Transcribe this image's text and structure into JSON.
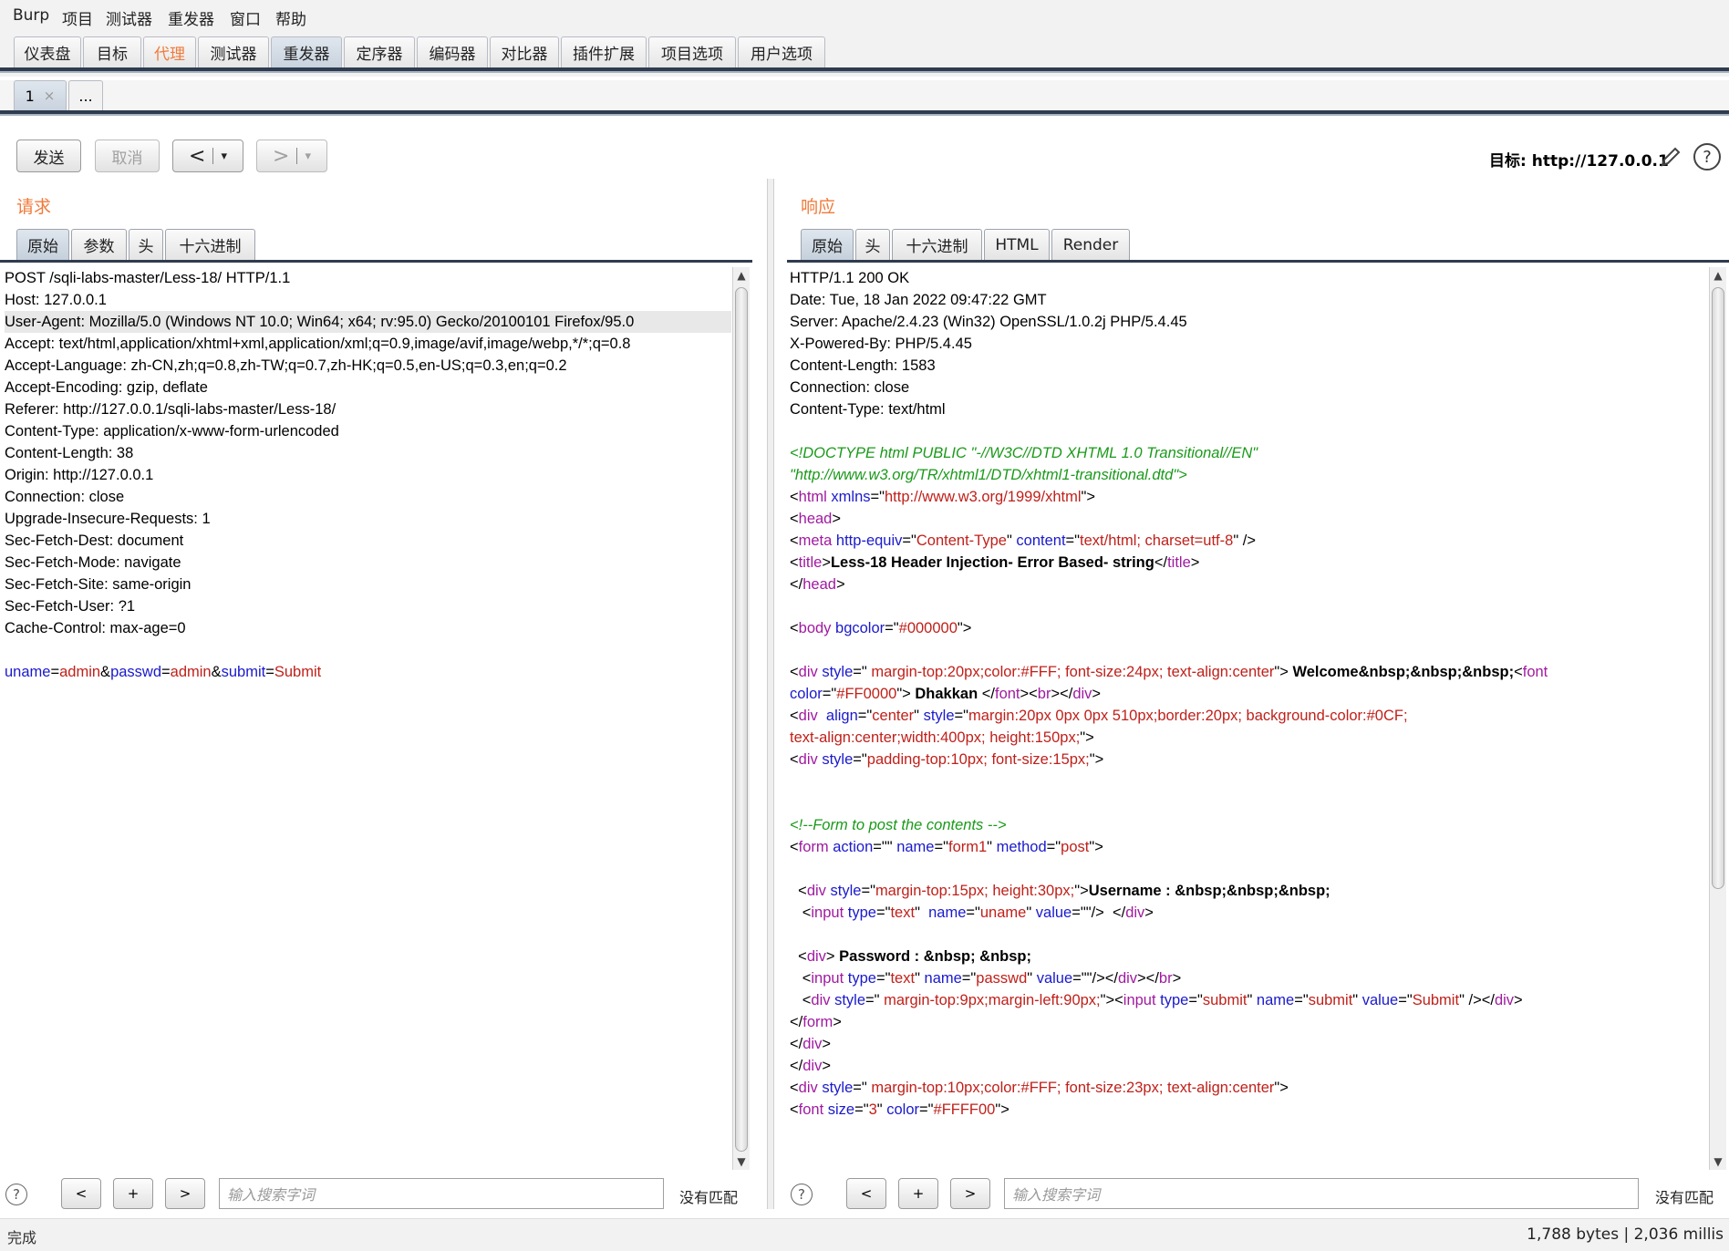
{
  "menu": [
    "Burp",
    "项目",
    "测试器",
    "重发器",
    "窗口",
    "帮助"
  ],
  "main_tabs": [
    "仪表盘",
    "目标",
    "代理",
    "测试器",
    "重发器",
    "定序器",
    "编码器",
    "对比器",
    "插件扩展",
    "项目选项",
    "用户选项"
  ],
  "repeater_tabs": {
    "tab1": "1",
    "close": "×",
    "more": "..."
  },
  "toolbar": {
    "send": "发送",
    "cancel": "取消",
    "back": "<",
    "forward": ">",
    "dropdown": "▾",
    "target_label": "目标:",
    "target_url": "http://127.0.0.1"
  },
  "request": {
    "title": "请求",
    "tabs": [
      "原始",
      "参数",
      "头",
      "十六进制"
    ],
    "lines": [
      "POST /sqli-labs-master/Less-18/ HTTP/1.1",
      "Host: 127.0.0.1",
      "User-Agent: Mozilla/5.0 (Windows NT 10.0; Win64; x64; rv:95.0) Gecko/20100101 Firefox/95.0",
      "Accept: text/html,application/xhtml+xml,application/xml;q=0.9,image/avif,image/webp,*/*;q=0.8",
      "Accept-Language: zh-CN,zh;q=0.8,zh-TW;q=0.7,zh-HK;q=0.5,en-US;q=0.3,en;q=0.2",
      "Accept-Encoding: gzip, deflate",
      "Referer: http://127.0.0.1/sqli-labs-master/Less-18/",
      "Content-Type: application/x-www-form-urlencoded",
      "Content-Length: 38",
      "Origin: http://127.0.0.1",
      "Connection: close",
      "Upgrade-Insecure-Requests: 1",
      "Sec-Fetch-Dest: document",
      "Sec-Fetch-Mode: navigate",
      "Sec-Fetch-Site: same-origin",
      "Sec-Fetch-User: ?1",
      "Cache-Control: max-age=0"
    ],
    "body_params": [
      {
        "name": "uname",
        "value": "admin"
      },
      {
        "name": "passwd",
        "value": "admin"
      },
      {
        "name": "submit",
        "value": "Submit"
      }
    ]
  },
  "response": {
    "title": "响应",
    "tabs": [
      "原始",
      "头",
      "十六进制",
      "HTML",
      "Render"
    ],
    "headers": [
      "HTTP/1.1 200 OK",
      "Date: Tue, 18 Jan 2022 09:47:22 GMT",
      "Server: Apache/2.4.23 (Win32) OpenSSL/1.0.2j PHP/5.4.45",
      "X-Powered-By: PHP/5.4.45",
      "Content-Length: 1583",
      "Connection: close",
      "Content-Type: text/html"
    ],
    "html_lines": [
      [
        [
          "c",
          "<!DOCTYPE html PUBLIC \"-//W3C//DTD XHTML 1.0 Transitional//EN\""
        ]
      ],
      [
        [
          "c",
          "\"http://www.w3.org/TR/xhtml1/DTD/xhtml1-transitional.dtd\">"
        ]
      ],
      [
        [
          "p",
          "<"
        ],
        [
          "t",
          "html"
        ],
        [
          "p",
          " "
        ],
        [
          "a",
          "xmlns"
        ],
        [
          "p",
          "=\""
        ],
        [
          "v",
          "http://www.w3.org/1999/xhtml"
        ],
        [
          "p",
          "\">"
        ]
      ],
      [
        [
          "p",
          "<"
        ],
        [
          "t",
          "head"
        ],
        [
          "p",
          ">"
        ]
      ],
      [
        [
          "p",
          "<"
        ],
        [
          "t",
          "meta"
        ],
        [
          "p",
          " "
        ],
        [
          "a",
          "http-equiv"
        ],
        [
          "p",
          "=\""
        ],
        [
          "v",
          "Content-Type"
        ],
        [
          "p",
          "\" "
        ],
        [
          "a",
          "content"
        ],
        [
          "p",
          "=\""
        ],
        [
          "v",
          "text/html; charset=utf-8"
        ],
        [
          "p",
          "\" />"
        ]
      ],
      [
        [
          "p",
          "<"
        ],
        [
          "t",
          "title"
        ],
        [
          "p",
          ">"
        ],
        [
          "b",
          "Less-18 Header Injection- Error Based- string"
        ],
        [
          "p",
          "</"
        ],
        [
          "t",
          "title"
        ],
        [
          "p",
          ">"
        ]
      ],
      [
        [
          "p",
          "</"
        ],
        [
          "t",
          "head"
        ],
        [
          "p",
          ">"
        ]
      ],
      [],
      [
        [
          "p",
          "<"
        ],
        [
          "t",
          "body"
        ],
        [
          "p",
          " "
        ],
        [
          "a",
          "bgcolor"
        ],
        [
          "p",
          "=\""
        ],
        [
          "v",
          "#000000"
        ],
        [
          "p",
          "\">"
        ]
      ],
      [],
      [
        [
          "p",
          "<"
        ],
        [
          "t",
          "div"
        ],
        [
          "p",
          " "
        ],
        [
          "a",
          "style"
        ],
        [
          "p",
          "=\""
        ],
        [
          "v",
          " margin-top:20px;color:#FFF; font-size:24px; text-align:center"
        ],
        [
          "p",
          "\"> "
        ],
        [
          "b",
          "Welcome&nbsp;&nbsp;&nbsp;"
        ],
        [
          "p",
          "<"
        ],
        [
          "t",
          "font"
        ]
      ],
      [
        [
          "a",
          "color"
        ],
        [
          "p",
          "=\""
        ],
        [
          "v",
          "#FF0000"
        ],
        [
          "p",
          "\"> "
        ],
        [
          "b",
          "Dhakkan"
        ],
        [
          "p",
          " </"
        ],
        [
          "t",
          "font"
        ],
        [
          "p",
          "><"
        ],
        [
          "t",
          "br"
        ],
        [
          "p",
          "></"
        ],
        [
          "t",
          "div"
        ],
        [
          "p",
          ">"
        ]
      ],
      [
        [
          "p",
          "<"
        ],
        [
          "t",
          "div"
        ],
        [
          "p",
          "  "
        ],
        [
          "a",
          "align"
        ],
        [
          "p",
          "=\""
        ],
        [
          "v",
          "center"
        ],
        [
          "p",
          "\" "
        ],
        [
          "a",
          "style"
        ],
        [
          "p",
          "=\""
        ],
        [
          "v",
          "margin:20px 0px 0px 510px;border:20px; background-color:#0CF;"
        ]
      ],
      [
        [
          "v",
          "text-align:center;width:400px; height:150px;"
        ],
        [
          "p",
          "\">"
        ]
      ],
      [
        [
          "p",
          "<"
        ],
        [
          "t",
          "div"
        ],
        [
          "p",
          " "
        ],
        [
          "a",
          "style"
        ],
        [
          "p",
          "=\""
        ],
        [
          "v",
          "padding-top:10px; font-size:15px;"
        ],
        [
          "p",
          "\">"
        ]
      ],
      [],
      [],
      [
        [
          "c",
          "<!--Form to post the contents -->"
        ]
      ],
      [
        [
          "p",
          "<"
        ],
        [
          "t",
          "form"
        ],
        [
          "p",
          " "
        ],
        [
          "a",
          "action"
        ],
        [
          "p",
          "=\"\" "
        ],
        [
          "a",
          "name"
        ],
        [
          "p",
          "=\""
        ],
        [
          "v",
          "form1"
        ],
        [
          "p",
          "\" "
        ],
        [
          "a",
          "method"
        ],
        [
          "p",
          "=\""
        ],
        [
          "v",
          "post"
        ],
        [
          "p",
          "\">"
        ]
      ],
      [],
      [
        [
          "p",
          "  <"
        ],
        [
          "t",
          "div"
        ],
        [
          "p",
          " "
        ],
        [
          "a",
          "style"
        ],
        [
          "p",
          "=\""
        ],
        [
          "v",
          "margin-top:15px; height:30px;"
        ],
        [
          "p",
          "\">"
        ],
        [
          "b",
          "Username : &nbsp;&nbsp;&nbsp;"
        ]
      ],
      [
        [
          "p",
          "   <"
        ],
        [
          "t",
          "input"
        ],
        [
          "p",
          " "
        ],
        [
          "a",
          "type"
        ],
        [
          "p",
          "=\""
        ],
        [
          "v",
          "text"
        ],
        [
          "p",
          "\"  "
        ],
        [
          "a",
          "name"
        ],
        [
          "p",
          "=\""
        ],
        [
          "v",
          "uname"
        ],
        [
          "p",
          "\" "
        ],
        [
          "a",
          "value"
        ],
        [
          "p",
          "=\"\"/>  </"
        ],
        [
          "t",
          "div"
        ],
        [
          "p",
          ">"
        ]
      ],
      [],
      [
        [
          "p",
          "  <"
        ],
        [
          "t",
          "div"
        ],
        [
          "p",
          "> "
        ],
        [
          "b",
          "Password : &nbsp; &nbsp;"
        ]
      ],
      [
        [
          "p",
          "   <"
        ],
        [
          "t",
          "input"
        ],
        [
          "p",
          " "
        ],
        [
          "a",
          "type"
        ],
        [
          "p",
          "=\""
        ],
        [
          "v",
          "text"
        ],
        [
          "p",
          "\" "
        ],
        [
          "a",
          "name"
        ],
        [
          "p",
          "=\""
        ],
        [
          "v",
          "passwd"
        ],
        [
          "p",
          "\" "
        ],
        [
          "a",
          "value"
        ],
        [
          "p",
          "=\"\"/></"
        ],
        [
          "t",
          "div"
        ],
        [
          "p",
          "></"
        ],
        [
          "t",
          "br"
        ],
        [
          "p",
          ">"
        ]
      ],
      [
        [
          "p",
          "   <"
        ],
        [
          "t",
          "div"
        ],
        [
          "p",
          " "
        ],
        [
          "a",
          "style"
        ],
        [
          "p",
          "=\""
        ],
        [
          "v",
          " margin-top:9px;margin-left:90px;"
        ],
        [
          "p",
          "\"><"
        ],
        [
          "t",
          "input"
        ],
        [
          "p",
          " "
        ],
        [
          "a",
          "type"
        ],
        [
          "p",
          "=\""
        ],
        [
          "v",
          "submit"
        ],
        [
          "p",
          "\" "
        ],
        [
          "a",
          "name"
        ],
        [
          "p",
          "=\""
        ],
        [
          "v",
          "submit"
        ],
        [
          "p",
          "\" "
        ],
        [
          "a",
          "value"
        ],
        [
          "p",
          "=\""
        ],
        [
          "v",
          "Submit"
        ],
        [
          "p",
          "\" /></"
        ],
        [
          "t",
          "div"
        ],
        [
          "p",
          ">"
        ]
      ],
      [
        [
          "p",
          "</"
        ],
        [
          "t",
          "form"
        ],
        [
          "p",
          ">"
        ]
      ],
      [
        [
          "p",
          "</"
        ],
        [
          "t",
          "div"
        ],
        [
          "p",
          ">"
        ]
      ],
      [
        [
          "p",
          "</"
        ],
        [
          "t",
          "div"
        ],
        [
          "p",
          ">"
        ]
      ],
      [
        [
          "p",
          "<"
        ],
        [
          "t",
          "div"
        ],
        [
          "p",
          " "
        ],
        [
          "a",
          "style"
        ],
        [
          "p",
          "=\""
        ],
        [
          "v",
          " margin-top:10px;color:#FFF; font-size:23px; text-align:center"
        ],
        [
          "p",
          "\">"
        ]
      ],
      [
        [
          "p",
          "<"
        ],
        [
          "t",
          "font"
        ],
        [
          "p",
          " "
        ],
        [
          "a",
          "size"
        ],
        [
          "p",
          "=\""
        ],
        [
          "v",
          "3"
        ],
        [
          "p",
          "\" "
        ],
        [
          "a",
          "color"
        ],
        [
          "p",
          "=\""
        ],
        [
          "v",
          "#FFFF00"
        ],
        [
          "p",
          "\">"
        ]
      ]
    ]
  },
  "search": {
    "help": "?",
    "prev": "<",
    "add": "+",
    "next": ">",
    "placeholder": "输入搜索字词",
    "no_match": "没有匹配"
  },
  "status": {
    "left": "完成",
    "right": "1,788 bytes | 2,036 millis"
  },
  "colors": {
    "accent_orange": "#f07a3b",
    "tag": "#a01aa0",
    "attr": "#1a1acc",
    "value": "#c0201a",
    "comment": "#1a9a1a"
  }
}
